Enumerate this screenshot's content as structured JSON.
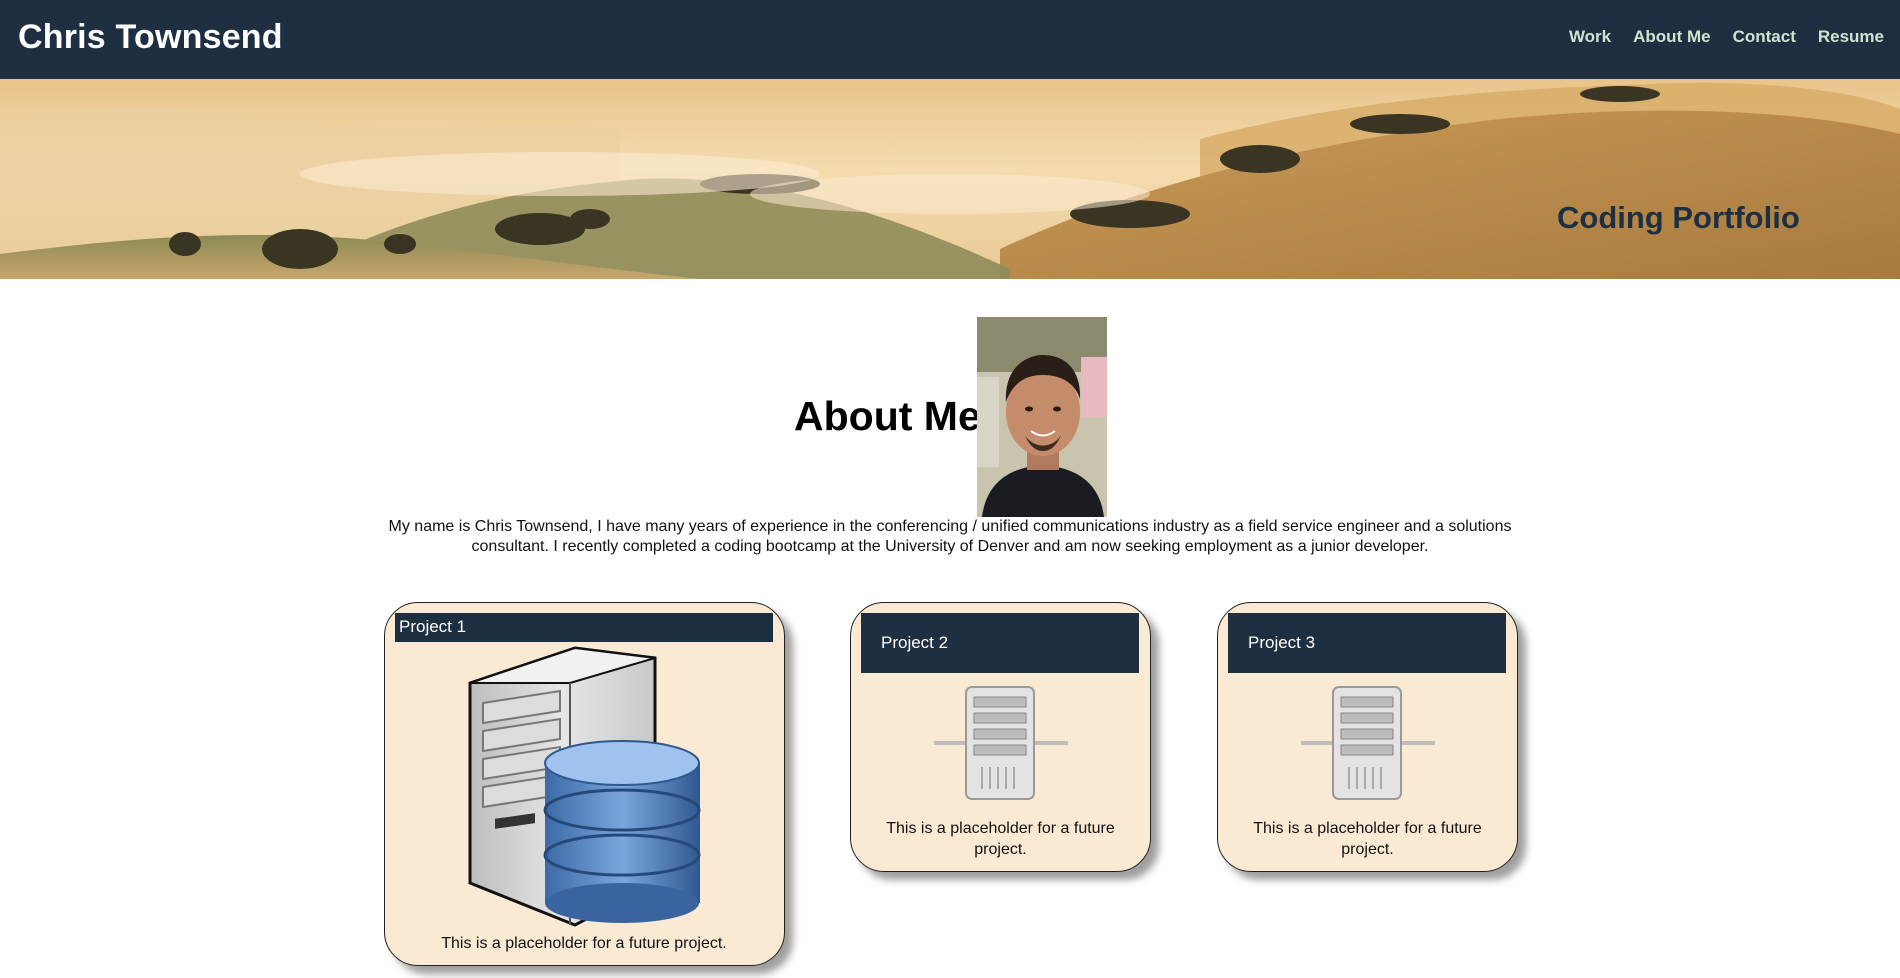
{
  "header": {
    "site_title": "Chris Townsend",
    "nav": [
      "Work",
      "About Me",
      "Contact",
      "Resume"
    ]
  },
  "hero": {
    "caption": "Coding Portfolio"
  },
  "about": {
    "heading": "About Me",
    "bio": "My name is Chris Townsend, I have many years of experience in the conferencing / unified communications industry as a field service engineer and a solutions consultant. I recently completed a coding bootcamp at the University of Denver and am now seeking employment as a junior developer."
  },
  "projects": [
    {
      "title": "Project 1",
      "description": "This is a placeholder for a future project.",
      "icon": "database-server-icon"
    },
    {
      "title": "Project 2",
      "description": "This is a placeholder for a future project.",
      "icon": "server-icon"
    },
    {
      "title": "Project 3",
      "description": "This is a placeholder for a future project.",
      "icon": "server-icon"
    }
  ],
  "colors": {
    "header_bg": "#1f2f42",
    "nav_link": "#cfe3cf",
    "card_bg": "#faead4",
    "card_header_bg": "#1f2f42"
  }
}
